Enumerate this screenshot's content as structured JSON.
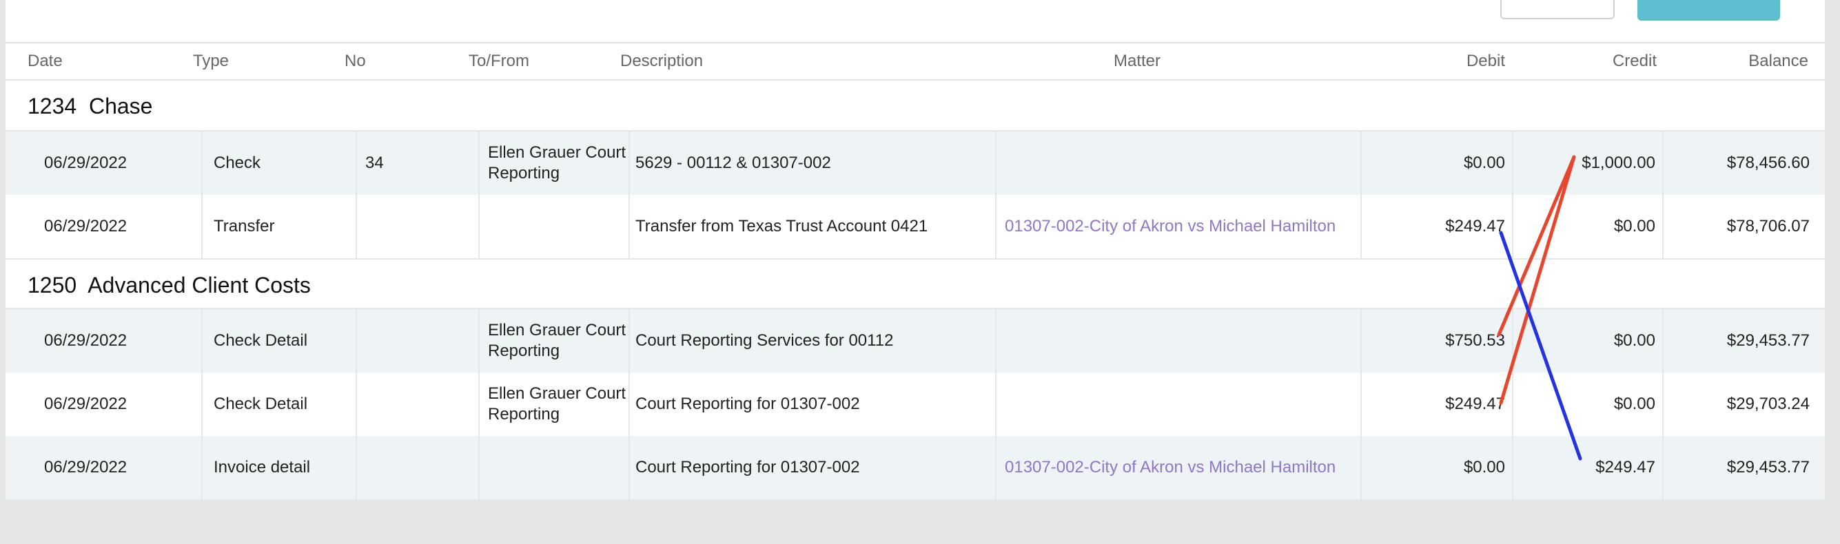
{
  "header": {
    "date": "Date",
    "type": "Type",
    "no": "No",
    "to_from": "To/From",
    "description": "Description",
    "matter": "Matter",
    "debit": "Debit",
    "credit": "Credit",
    "balance": "Balance"
  },
  "groups": [
    {
      "title": "1234  Chase",
      "rows": [
        {
          "date": "06/29/2022",
          "type": "Check",
          "no": "34",
          "to_from": "Ellen Grauer Court Reporting",
          "description": "5629 - 00112 & 01307-002",
          "matter": "",
          "debit": "$0.00",
          "credit": "$1,000.00",
          "balance": "$78,456.60"
        },
        {
          "date": "06/29/2022",
          "type": "Transfer",
          "no": "",
          "to_from": "",
          "description": "Transfer from Texas Trust Account 0421",
          "matter": "01307-002-City of Akron vs Michael Hamilton",
          "debit": "$249.47",
          "credit": "$0.00",
          "balance": "$78,706.07"
        }
      ]
    },
    {
      "title": "1250  Advanced Client Costs",
      "rows": [
        {
          "date": "06/29/2022",
          "type": "Check Detail",
          "no": "",
          "to_from": "Ellen Grauer Court Reporting",
          "description": "Court Reporting Services for 00112",
          "matter": "",
          "debit": "$750.53",
          "credit": "$0.00",
          "balance": "$29,453.77"
        },
        {
          "date": "06/29/2022",
          "type": "Check Detail",
          "no": "",
          "to_from": "Ellen Grauer Court Reporting",
          "description": "Court Reporting for 01307-002",
          "matter": "",
          "debit": "$249.47",
          "credit": "$0.00",
          "balance": "$29,703.24"
        },
        {
          "date": "06/29/2022",
          "type": "Invoice detail",
          "no": "",
          "to_from": "",
          "description": "Court Reporting for 01307-002",
          "matter": "01307-002-City of Akron vs Michael Hamilton",
          "debit": "$0.00",
          "credit": "$249.47",
          "balance": "$29,453.77"
        }
      ]
    }
  ],
  "annotation_colors": {
    "red": "#e8452c",
    "blue": "#2233e0"
  }
}
